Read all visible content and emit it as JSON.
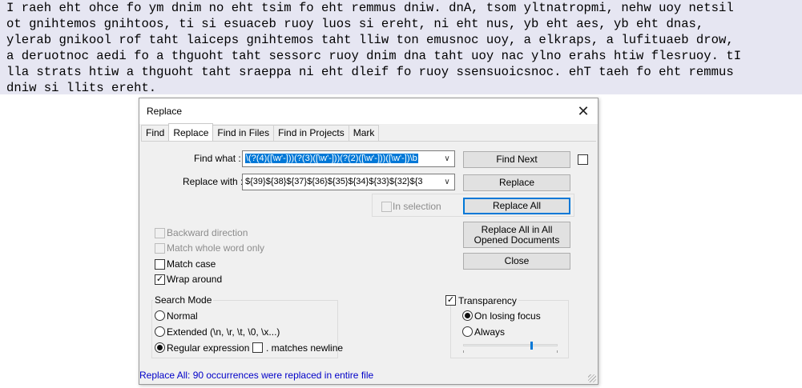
{
  "editor": {
    "lines": [
      "I raeh eht ohce fo ym dnim no eht tsim fo eht remmus dniw. dnA, tsom yltnatropmi, nehw uoy netsil",
      "ot gnihtemos gnihtoos, ti si esuaceb ruoy luos si ereht, ni eht nus, yb eht aes, yb eht dnas,",
      "ylerab gnikool rof taht laiceps gnihtemos taht lliw ton emusnoc uoy, a elkraps, a lufituaeb drow,",
      "a deruotnoc aedi fo a thguoht taht sessorc ruoy dnim dna taht uoy nac ylno erahs htiw flesruoy. tI",
      "lla strats htiw a thguoht taht sraeppa ni eht dleif fo ruoy ssensuoicsnoc. ehT taeh fo eht remmus",
      "dniw si llits ereht."
    ]
  },
  "dialog": {
    "title": "Replace",
    "close_glyph": "✕",
    "tabs": [
      "Find",
      "Replace",
      "Find in Files",
      "Find in Projects",
      "Mark"
    ],
    "find_label": "Find what :",
    "find_value": "\\(?(4)([\\w'-]))(?(3)([\\w'-]))(?(2)([\\w'-]))([\\w'-])\\b",
    "replace_label": "Replace with :",
    "replace_value": "${39}${38}${37}${36}${35}${34}${33}${32}${3",
    "in_selection_label": "In selection",
    "buttons": {
      "find_next": "Find Next",
      "replace": "Replace",
      "replace_all": "Replace All",
      "replace_all_opened": "Replace All in All Opened Documents",
      "close": "Close"
    },
    "options": {
      "backward": "Backward direction",
      "whole_word": "Match whole word only",
      "match_case": "Match case",
      "wrap_around": "Wrap around"
    },
    "search_mode": {
      "title": "Search Mode",
      "normal": "Normal",
      "extended": "Extended (\\n, \\r, \\t, \\0, \\x...)",
      "regex": "Regular expression",
      "matches_newline": ". matches newline"
    },
    "transparency": {
      "title": "Transparency",
      "on_losing_focus": "On losing focus",
      "always": "Always",
      "slider_value": 0.72
    },
    "status": "Replace All: 90 occurrences were replaced in entire file",
    "check_glyph": "✓"
  }
}
